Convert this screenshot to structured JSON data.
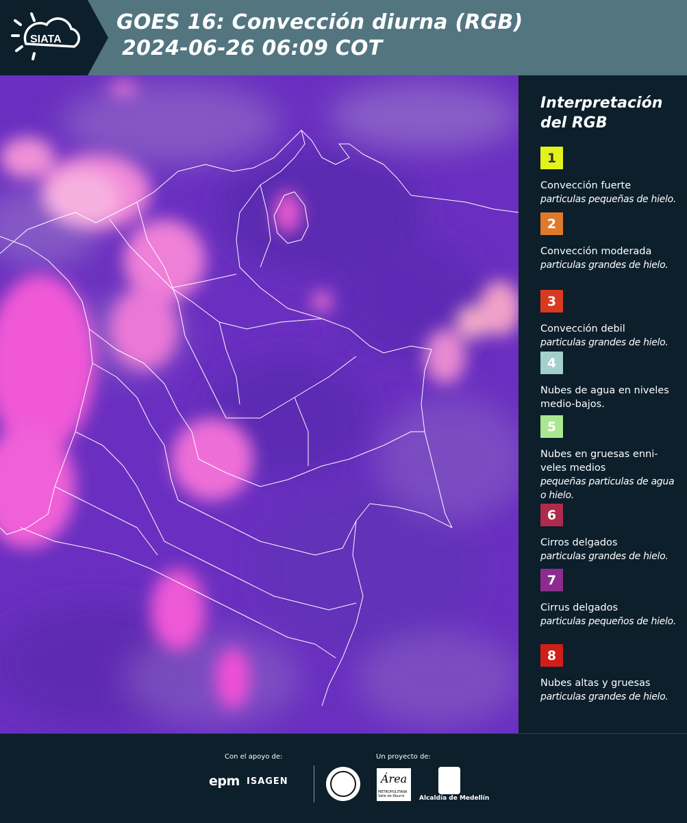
{
  "header": {
    "logo_text": "SIATA",
    "title_line1": "GOES 16: Convección diurna (RGB)",
    "title_line2": "2024-06-26 06:09 COT",
    "background": "#527580"
  },
  "legend": {
    "title_line1": "Interpretación",
    "title_line2": "del RGB",
    "items": [
      {
        "num": "1",
        "name": "Convección fuerte",
        "desc": "particulas pequeñas de hielo.",
        "color": "#e3f21a",
        "num_color": "#333333"
      },
      {
        "num": "2",
        "name": "Convección moderada",
        "desc": "particulas grandes de hielo.",
        "color": "#e07a2a",
        "num_color": "#ffffff"
      },
      {
        "num": "3",
        "name": "Convección debil",
        "desc": "particulas grandes de hielo.",
        "color": "#d93a1f",
        "num_color": "#ffffff"
      },
      {
        "num": "4",
        "name": "Nubes de agua en niveles medio-bajos.",
        "desc": "",
        "color": "#a3cfcc",
        "num_color": "#ffffff"
      },
      {
        "num": "5",
        "name": "Nubes en gruesas enni-veles medios",
        "desc": "pequeñas particulas de agua o hielo.",
        "color": "#a9e890",
        "num_color": "#ffffff"
      },
      {
        "num": "6",
        "name": "Cirros delgados",
        "desc": "particulas grandes de hielo.",
        "color": "#b02a4c",
        "num_color": "#ffffff"
      },
      {
        "num": "7",
        "name": "Cirrus delgados",
        "desc": "particulas pequeños de hielo.",
        "color": "#8e2b8e",
        "num_color": "#ffffff"
      },
      {
        "num": "8",
        "name": "Nubes altas y gruesas",
        "desc": "particulas grandes de hielo.",
        "color": "#cf1f18",
        "num_color": "#ffffff"
      }
    ]
  },
  "footer": {
    "support_label": "Con el apoyo de:",
    "project_label": "Un proyecto de:",
    "epm_text": "epm",
    "isagen_text": "ISAGEN",
    "area_text": "Área",
    "area_sub": "METROPOLITANA Valle de Aburrá",
    "alcaldia_text": "Alcaldía de Medellín"
  },
  "map": {
    "base_color": "#6a2fc0",
    "cloud_pink": "#f060d8",
    "cloud_light": "#f8a0e8",
    "border_color": "#ffffff"
  }
}
